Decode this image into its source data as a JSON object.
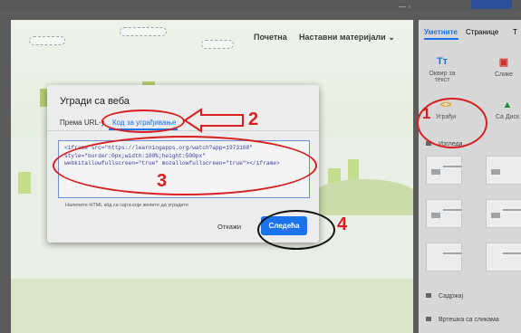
{
  "site": {
    "nav_home": "Почетна",
    "nav_materials": "Наставни материјали",
    "nav_chevron": "⌄"
  },
  "right_panel": {
    "tabs": [
      "Уметните",
      "Странице",
      "Т"
    ],
    "tiles": [
      {
        "icon": "Tт",
        "label": "Оквир за текст"
      },
      {
        "icon": "▣",
        "label": "Слике"
      },
      {
        "icon": "<>",
        "label": "Уграђи"
      },
      {
        "icon": "▲",
        "label": "Са Диск"
      }
    ],
    "layouts_label": "Изгледи",
    "list": [
      "Садржај",
      "Вртешка са сликама"
    ]
  },
  "dialog": {
    "title": "Угради са веба",
    "tabs": [
      "Према URL-у",
      "Код за уграђивање"
    ],
    "code": [
      "<iframe src=\"https://learningapps.org/watch?app=1973108\"",
      "style=\"border:0px;width:100%;height:500px\"",
      "webkitallowfullscreen=\"true\" mozallowfullscreen=\"true\"></iframe>"
    ],
    "hint": "Налепите HTML кôд са сајта који желите да уградите",
    "cancel": "Откажи",
    "next": "Следећа"
  },
  "annotations": [
    "1",
    "2",
    "3",
    "4"
  ],
  "colors": {
    "accent": "#1a73e8",
    "annotation": "#d81e1e"
  }
}
